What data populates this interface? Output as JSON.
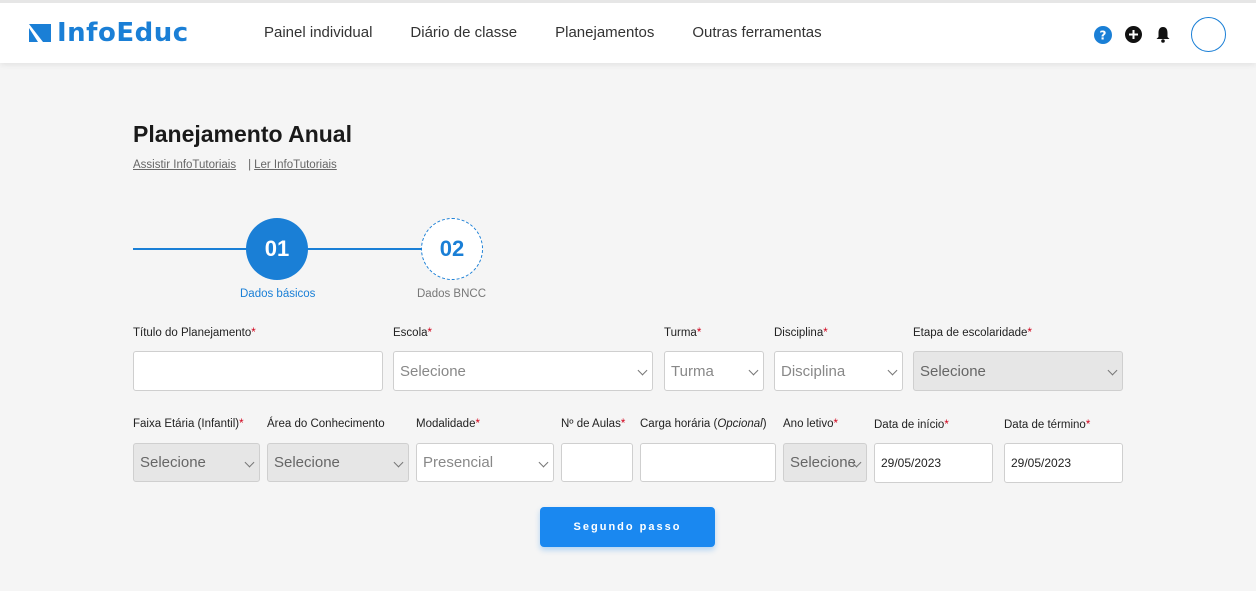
{
  "brand": {
    "name": "InfoEduc",
    "color": "#1a7fd6"
  },
  "nav": {
    "items": [
      "Painel individual",
      "Diário de classe",
      "Planejamentos",
      "Outras ferramentas"
    ]
  },
  "top_icons": [
    "help-icon",
    "add-icon",
    "bell-icon",
    "avatar"
  ],
  "page": {
    "title": "Planejamento Anual",
    "link_watch": "Assistir InfoTutoriais",
    "link_sep": "|",
    "link_read": "Ler InfoTutoriais"
  },
  "stepper": {
    "steps": [
      {
        "number": "01",
        "label": "Dados básicos",
        "active": true
      },
      {
        "number": "02",
        "label": "Dados BNCC",
        "active": false
      }
    ]
  },
  "form": {
    "titulo_label": "Título do Planejamento",
    "titulo_value": "",
    "escola_label": "Escola",
    "escola_value": "Selecione",
    "turma_label": "Turma",
    "turma_value": "Turma",
    "disciplina_label": "Disciplina",
    "disciplina_value": "Disciplina",
    "etapa_label": "Etapa de escolaridade",
    "etapa_value": "Selecione",
    "faixa_label": "Faixa Etária (Infantil)",
    "faixa_value": "Selecione",
    "area_label": "Área do Conhecimento",
    "area_value": "Selecione",
    "modalidade_label": "Modalidade",
    "modalidade_value": "Presencial",
    "aulas_label": "Nº de Aulas",
    "aulas_value": "",
    "carga_label": "Carga horária (",
    "carga_optional": "Opcional",
    "carga_close": ")",
    "carga_value": "",
    "ano_label": "Ano letivo",
    "ano_value": "Selecione",
    "inicio_label": "Data de início",
    "inicio_value": "29/05/2023",
    "termino_label": "Data de término",
    "termino_value": "29/05/2023",
    "required_mark": "*"
  },
  "actions": {
    "next_label": "Segundo passo"
  },
  "colors": {
    "accent": "#1a7fd6",
    "button": "#1a88f0",
    "required": "#d0021b"
  }
}
